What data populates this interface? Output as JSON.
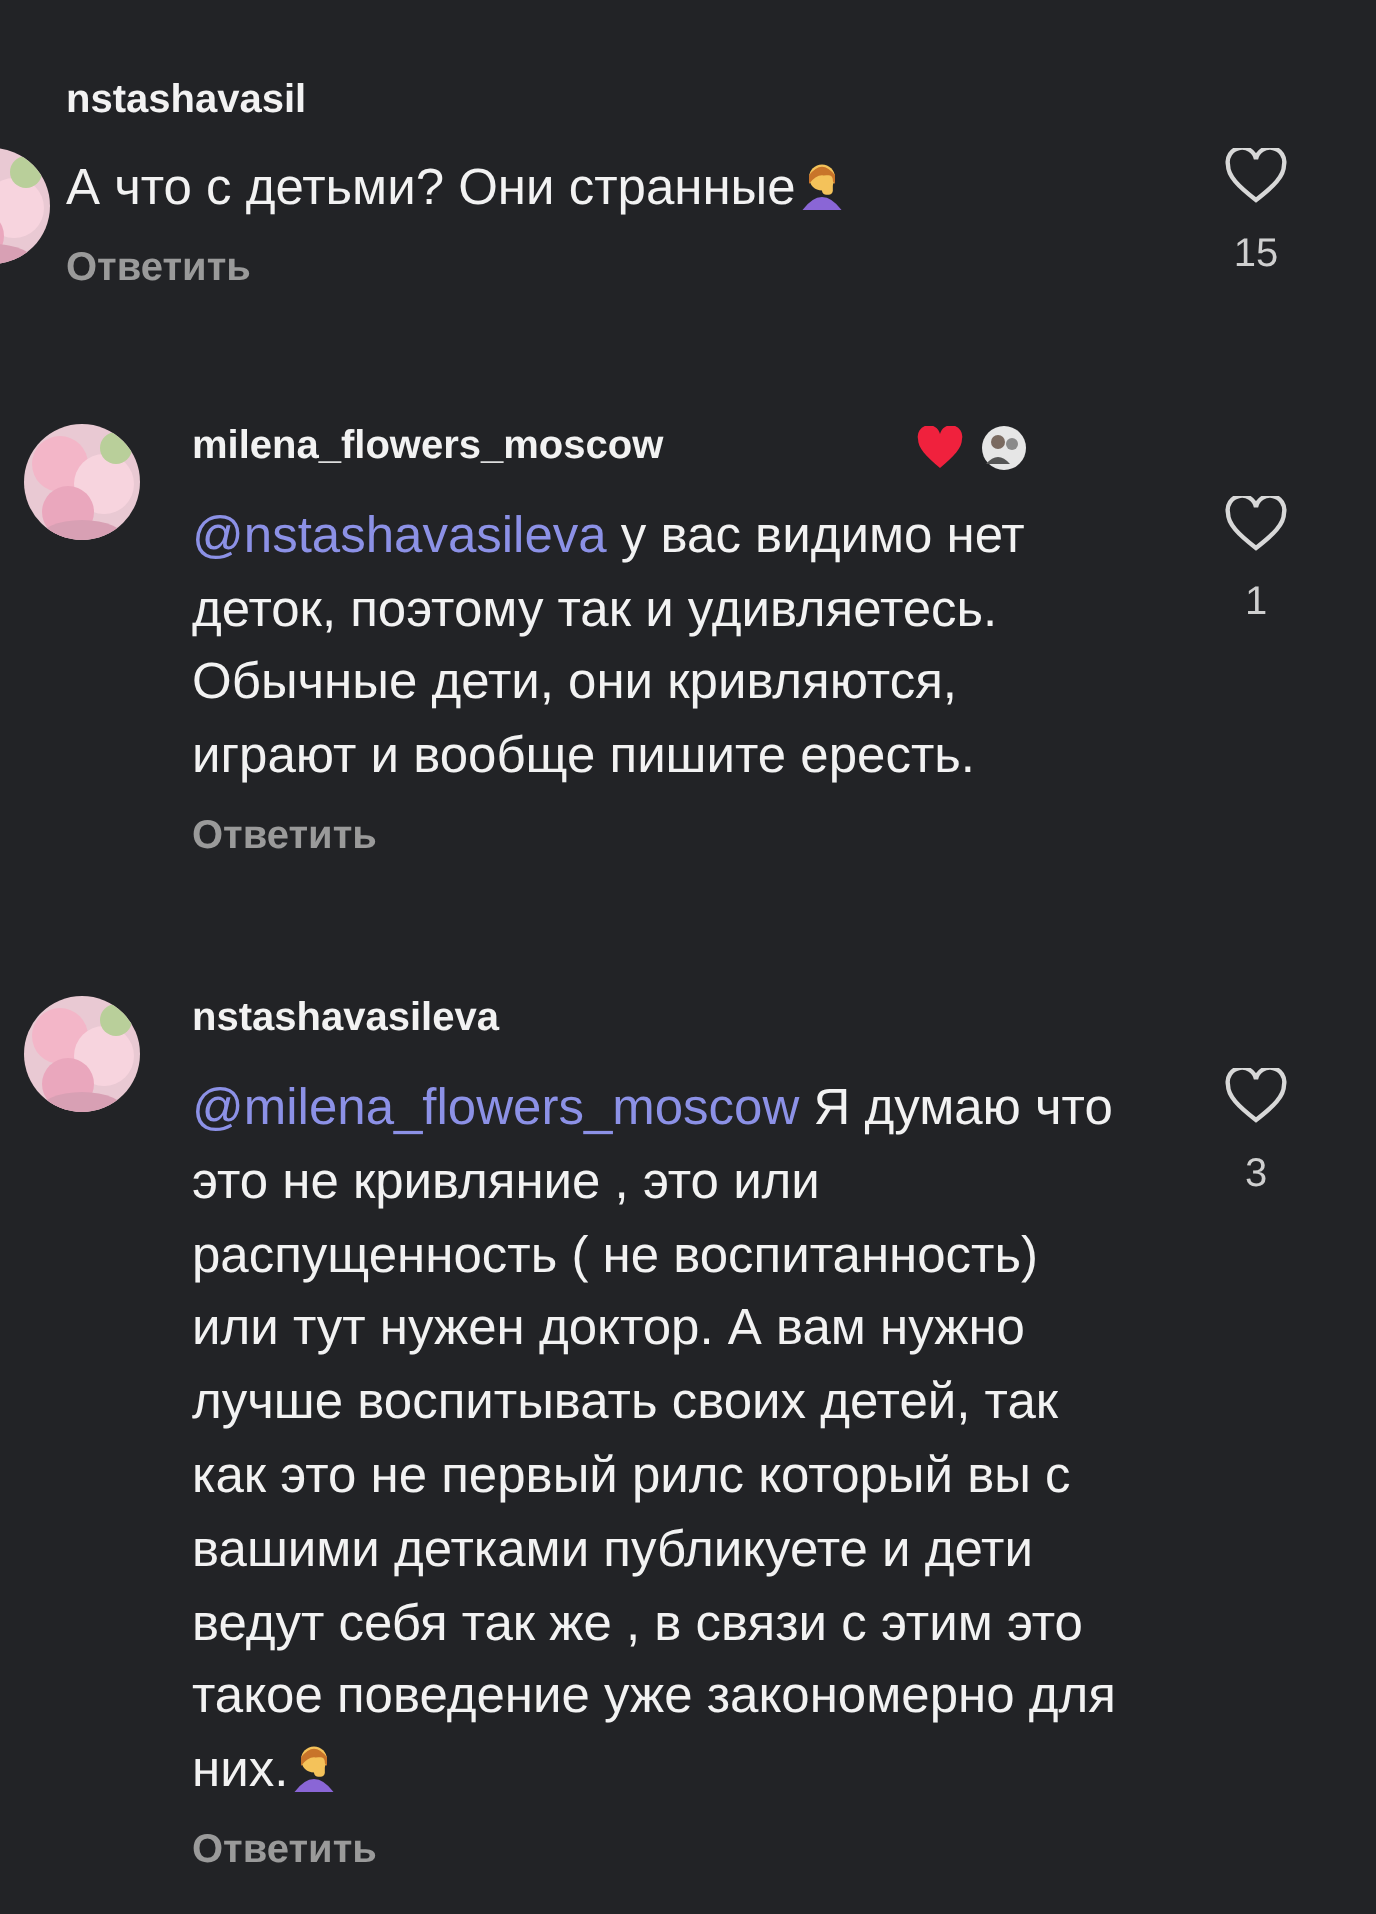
{
  "comments": [
    {
      "username": "nstashavasil",
      "indented": false,
      "liked_by_author": false,
      "body": "А что с детьми? Они странные",
      "ends_with_emoji": true,
      "reply": "Ответить",
      "likes": "15"
    },
    {
      "username": "milena_flowers_moscow",
      "indented": true,
      "liked_by_author": true,
      "mention": "@nstashavasileva",
      "body": "у вас видимо нет деток, поэтому так и удивляетесь. Обычные дети, они кривляются, играют и вообще пишите ересть.",
      "ends_with_emoji": false,
      "reply": "Ответить",
      "likes": "1"
    },
    {
      "username": "nstashavasileva",
      "indented": true,
      "liked_by_author": false,
      "mention": "@milena_flowers_moscow",
      "body": "Я думаю что это не кривляние , это или распущенность ( не воспитанность) или тут нужен доктор. А вам нужно лучше воспитывать своих детей, так как это не первый рилс который вы с вашими детками публикуете и дети ведут себя так же , в связи с этим это такое поведение уже закономерно для них.",
      "ends_with_emoji": true,
      "reply": "Ответить",
      "likes": "3"
    }
  ]
}
